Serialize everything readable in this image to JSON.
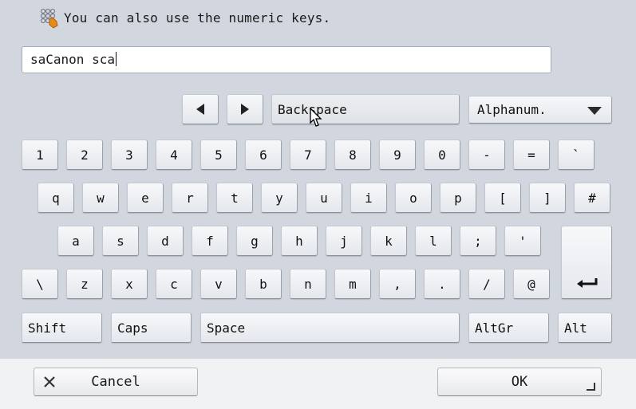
{
  "header": {
    "hint_icon": "keypad-hand-icon",
    "hint_text": "You can also use the numeric keys."
  },
  "input": {
    "value": "saCanon sca"
  },
  "controls": {
    "left_icon": "arrow-left-icon",
    "right_icon": "arrow-right-icon",
    "backspace_label": "Backspace",
    "mode_label": "Alphanum.",
    "mode_icon": "dropdown-triangle-icon"
  },
  "rows": [
    [
      "1",
      "2",
      "3",
      "4",
      "5",
      "6",
      "7",
      "8",
      "9",
      "0",
      "-",
      "=",
      "`"
    ],
    [
      "q",
      "w",
      "e",
      "r",
      "t",
      "y",
      "u",
      "i",
      "o",
      "p",
      "[",
      "]",
      "#"
    ],
    [
      "a",
      "s",
      "d",
      "f",
      "g",
      "h",
      "j",
      "k",
      "l",
      ";",
      "'"
    ],
    [
      "\\",
      "z",
      "x",
      "c",
      "v",
      "b",
      "n",
      "m",
      ",",
      ".",
      "/",
      "@"
    ]
  ],
  "enter_icon": "enter-return-icon",
  "function_keys": {
    "shift": "Shift",
    "caps": "Caps",
    "space": "Space",
    "altgr": "AltGr",
    "alt": "Alt"
  },
  "footer": {
    "cancel_label": "Cancel",
    "cancel_icon": "close-x-icon",
    "ok_label": "OK",
    "ok_icon": "corner-indicator-icon"
  },
  "pointer_icon": "mouse-pointer-icon"
}
